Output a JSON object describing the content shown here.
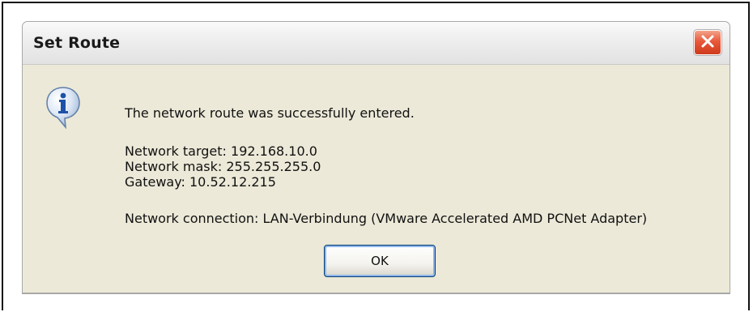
{
  "dialog": {
    "title": "Set Route",
    "message": {
      "headline": "The network route was successfully entered.",
      "network_target": "Network target: 192.168.10.0",
      "network_mask": "Network mask: 255.255.255.0",
      "gateway": "Gateway: 10.52.12.215",
      "connection": "Network connection: LAN-Verbindung (VMware Accelerated AMD PCNet Adapter)"
    },
    "ok_label": "OK"
  },
  "icons": {
    "info": "info-icon",
    "close": "close-icon"
  },
  "colors": {
    "dialog_bg": "#ece9d8",
    "close_button": "#e8593a",
    "ok_focus_ring": "#8fb6ea"
  }
}
